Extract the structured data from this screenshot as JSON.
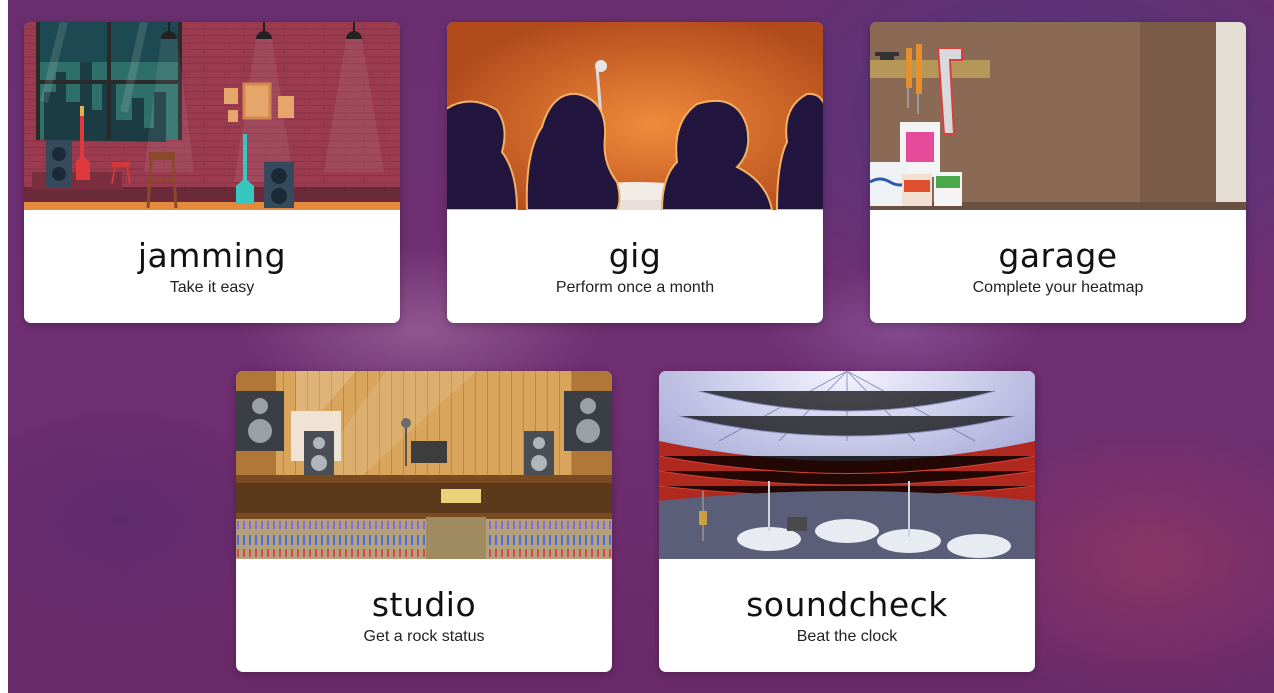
{
  "modes": [
    {
      "id": "jamming",
      "title": "jamming",
      "subtitle": "Take it easy"
    },
    {
      "id": "gig",
      "title": "gig",
      "subtitle": "Perform once a month"
    },
    {
      "id": "garage",
      "title": "garage",
      "subtitle": "Complete your heatmap"
    },
    {
      "id": "studio",
      "title": "studio",
      "subtitle": "Get a rock status"
    },
    {
      "id": "soundcheck",
      "title": "soundcheck",
      "subtitle": "Beat the clock"
    }
  ],
  "colors": {
    "background": "#6f2f72",
    "card": "#ffffff",
    "title_text": "#111111",
    "subtitle_text": "#222222"
  }
}
